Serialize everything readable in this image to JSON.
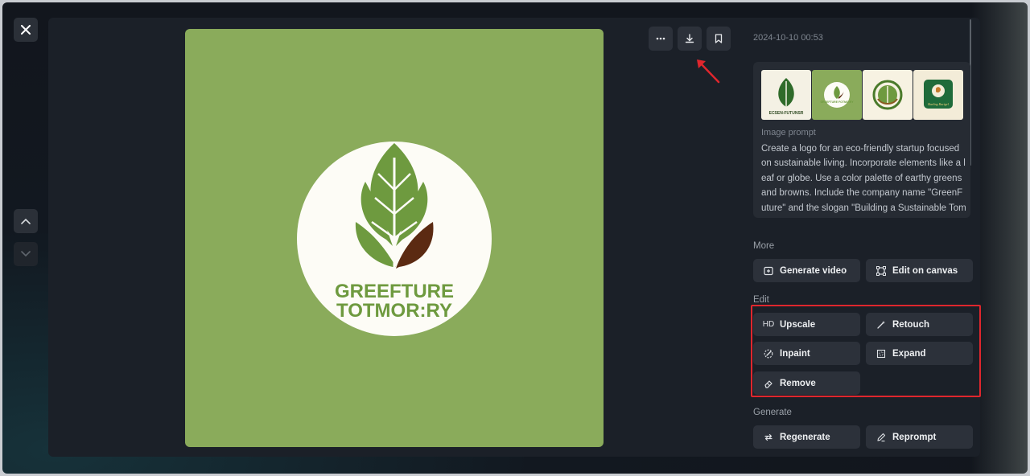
{
  "viewer": {
    "close_icon": "close-icon",
    "nav_up_icon": "chevron-up-icon",
    "nav_down_icon": "chevron-down-icon"
  },
  "image": {
    "logo_line1": "GREEFTURE",
    "logo_line2": "TOTMOR:RY",
    "background_color": "#8aab5b",
    "leaf_color": "#6e9a3f",
    "brown_leaf_color": "#5b2a12"
  },
  "image_actions": {
    "more_icon": "more-horizontal-icon",
    "download_icon": "download-icon",
    "bookmark_icon": "bookmark-icon"
  },
  "details": {
    "timestamp": "2024-10-10 00:53",
    "thumbnail_texts": [
      "ECSEN-FUTUNSR",
      "GREEFTURE FOTMO:RY",
      "",
      "Baeling Racigel"
    ],
    "prompt_label": "Image prompt",
    "prompt_text": "Create a logo for an eco-friendly startup focused on sustainable living. Incorporate elements like a leaf or globe. Use a color palette of earthy greens and browns. Include the company name \"GreenFuture\" and the slogan \"Building a Sustainable Tomor"
  },
  "more_section": {
    "label": "More",
    "generate_video": "Generate video",
    "edit_on_canvas": "Edit on canvas"
  },
  "edit_section": {
    "label": "Edit",
    "upscale_badge": "HD",
    "upscale": "Upscale",
    "retouch": "Retouch",
    "inpaint": "Inpaint",
    "expand": "Expand",
    "remove": "Remove"
  },
  "generate_section": {
    "label": "Generate",
    "regenerate": "Regenerate",
    "reprompt": "Reprompt"
  },
  "colors": {
    "highlight": "#e0262d",
    "annotation_arrow": "#e0262d"
  }
}
